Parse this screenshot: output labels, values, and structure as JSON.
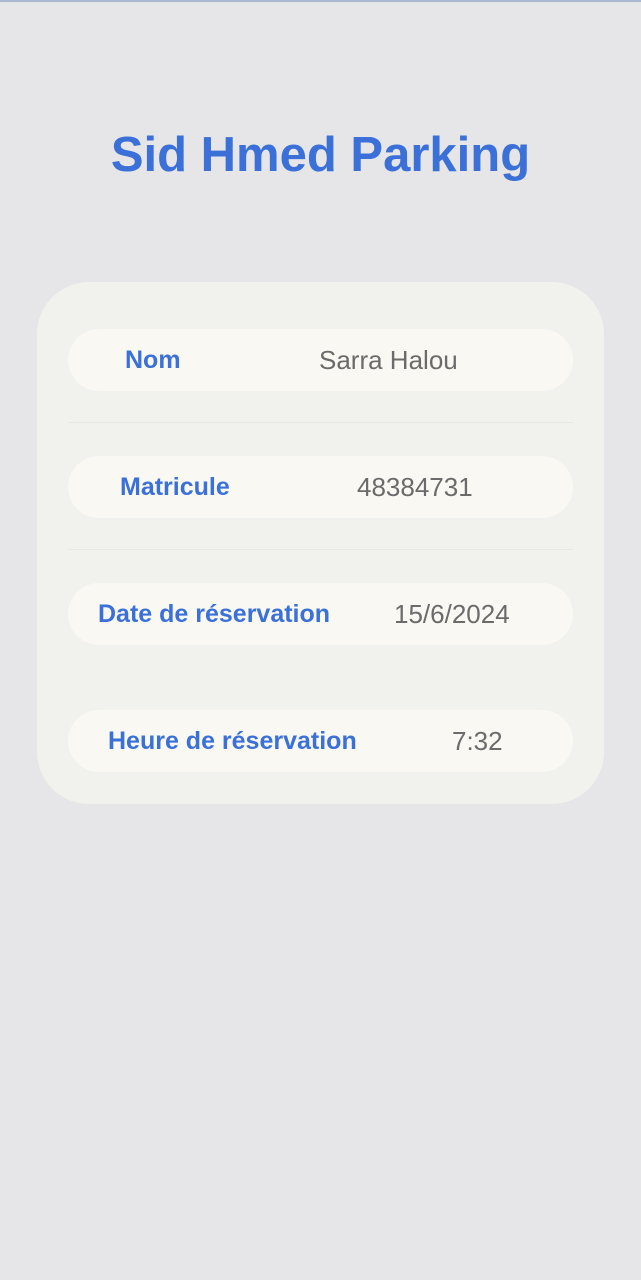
{
  "app": {
    "title": "Sid Hmed Parking"
  },
  "reservation": {
    "name_label": "Nom",
    "name_value": "Sarra Halou",
    "plate_label": "Matricule",
    "plate_value": "48384731",
    "date_label": "Date de réservation",
    "date_value": "15/6/2024",
    "time_label": "Heure de réservation",
    "time_value": "7:32"
  },
  "colors": {
    "accent": "#3a70d8",
    "background": "#e6e6e8",
    "card": "#f1f1ee",
    "row": "#f9f8f3",
    "value_text": "#6b6b6b"
  }
}
